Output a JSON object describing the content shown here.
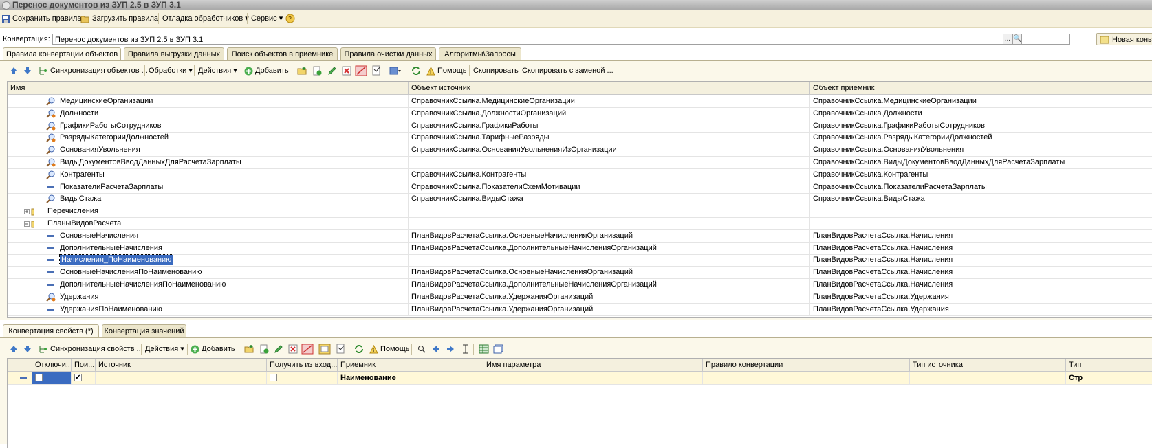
{
  "window": {
    "title": "Перенос документов из ЗУП 2.5 в ЗУП 3.1"
  },
  "main_toolbar": {
    "save_rules": "Сохранить правила",
    "load_rules": "Загрузить правила",
    "debug_handlers": "Отладка обработчиков",
    "service": "Сервис"
  },
  "conversion": {
    "label": "Конвертация:",
    "value": "Перенос документов из ЗУП 2.5 в ЗУП 3.1",
    "select_button": "...",
    "search_button": "🔍",
    "new_conversion": "Новая конв"
  },
  "top_tabs": [
    "Правила конвертации объектов",
    "Правила выгрузки данных",
    "Поиск объектов в приемнике",
    "Правила очистки данных",
    "Алгоритмы\\Запросы"
  ],
  "rules_toolbar": {
    "sync": "Синхронизация объектов ...",
    "processing": "Обработки",
    "actions": "Действия",
    "add": "Добавить",
    "help": "Помощь",
    "copy": "Скопировать",
    "copy_replace": "Скопировать с заменой ..."
  },
  "rules_grid": {
    "columns": [
      "Имя",
      "Объект источник",
      "Объект приемник"
    ],
    "rows": [
      {
        "icon": "search-icon",
        "name": "МедицинскиеОрганизации",
        "src": "СправочникСсылка.МедицинскиеОрганизации",
        "dst": "СправочникСсылка.МедицинскиеОрганизации"
      },
      {
        "icon": "search-plus-icon",
        "name": "Должности",
        "src": "СправочникСсылка.ДолжностиОрганизаций",
        "dst": "СправочникСсылка.Должности"
      },
      {
        "icon": "search-plus-icon",
        "name": "ГрафикиРаботыСотрудников",
        "src": "СправочникСсылка.ГрафикиРаботы",
        "dst": "СправочникСсылка.ГрафикиРаботыСотрудников"
      },
      {
        "icon": "search-plus-icon",
        "name": "РазрядыКатегорииДолжностей",
        "src": "СправочникСсылка.ТарифныеРазряды",
        "dst": "СправочникСсылка.РазрядыКатегорииДолжностей"
      },
      {
        "icon": "search-icon",
        "name": "ОснованияУвольнения",
        "src": "СправочникСсылка.ОснованияУвольненияИзОрганизации",
        "dst": "СправочникСсылка.ОснованияУвольнения"
      },
      {
        "icon": "search-plus-icon",
        "name": "ВидыДокументовВводДанныхДляРасчетаЗарплаты",
        "src": "",
        "dst": "СправочникСсылка.ВидыДокументовВводДанныхДляРасчетаЗарплаты"
      },
      {
        "icon": "search-icon",
        "name": "Контрагенты",
        "src": "СправочникСсылка.Контрагенты",
        "dst": "СправочникСсылка.Контрагенты"
      },
      {
        "icon": "equals-icon",
        "name": "ПоказателиРасчетаЗарплаты",
        "src": "СправочникСсылка.ПоказателиСхемМотивации",
        "dst": "СправочникСсылка.ПоказателиРасчетаЗарплаты"
      },
      {
        "icon": "search-icon",
        "name": "ВидыСтажа",
        "src": "СправочникСсылка.ВидыСтажа",
        "dst": "СправочникСсылка.ВидыСтажа"
      },
      {
        "icon": "folder-plus-icon",
        "name": "Перечисления",
        "src": "",
        "dst": ""
      },
      {
        "icon": "folder-minus-icon",
        "name": "ПланыВидовРасчета",
        "src": "",
        "dst": ""
      },
      {
        "icon": "equals-icon",
        "name": "ОсновныеНачисления",
        "src": "ПланВидовРасчетаСсылка.ОсновныеНачисленияОрганизаций",
        "dst": "ПланВидовРасчетаСсылка.Начисления"
      },
      {
        "icon": "equals-icon",
        "name": "ДополнительныеНачисления",
        "src": "ПланВидовРасчетаСсылка.ДополнительныеНачисленияОрганизаций",
        "dst": "ПланВидовРасчетаСсылка.Начисления"
      },
      {
        "icon": "equals-icon",
        "name": "Начисления_ПоНаименованию",
        "src": "",
        "dst": "ПланВидовРасчетаСсылка.Начисления",
        "selected": true
      },
      {
        "icon": "equals-icon",
        "name": "ОсновныеНачисленияПоНаименованию",
        "src": "ПланВидовРасчетаСсылка.ОсновныеНачисленияОрганизаций",
        "dst": "ПланВидовРасчетаСсылка.Начисления"
      },
      {
        "icon": "equals-icon",
        "name": "ДополнительныеНачисленияПоНаименованию",
        "src": "ПланВидовРасчетаСсылка.ДополнительныеНачисленияОрганизаций",
        "dst": "ПланВидовРасчетаСсылка.Начисления"
      },
      {
        "icon": "search-plus-icon",
        "name": "Удержания",
        "src": "ПланВидовРасчетаСсылка.УдержанияОрганизаций",
        "dst": "ПланВидовРасчетаСсылка.Удержания"
      },
      {
        "icon": "equals-icon",
        "name": "УдержанияПоНаименованию",
        "src": "ПланВидовРасчетаСсылка.УдержанияОрганизаций",
        "dst": "ПланВидовРасчетаСсылка.Удержания"
      }
    ]
  },
  "bottom_tabs": [
    "Конвертация свойств (*)",
    "Конвертация значений"
  ],
  "props_toolbar": {
    "sync": "Синхронизация свойств ...",
    "actions": "Действия",
    "add": "Добавить",
    "help": "Помощь"
  },
  "props_grid": {
    "columns": [
      "Отключи...",
      "Пои...",
      "Источник",
      "Получить из вход...",
      "Приемник",
      "Имя параметра",
      "Правило конвертации",
      "Тип источника",
      "Тип"
    ],
    "row": {
      "disabled": false,
      "search": true,
      "source": "",
      "get_from_input": false,
      "target": "Наименование",
      "param": "",
      "rule": "",
      "src_type": "",
      "type": "Стр"
    }
  },
  "colors": {
    "panel_bg": "#fbf8ea",
    "toolbar_bg": "#f6f1de",
    "selection": "#3a6bc0",
    "icon_blue": "#4a6fb5"
  }
}
